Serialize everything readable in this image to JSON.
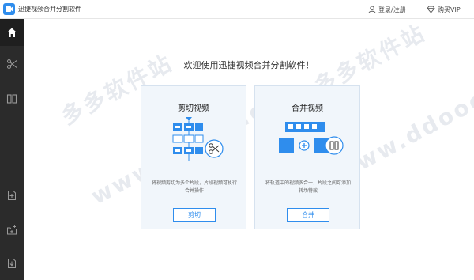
{
  "titlebar": {
    "title": "迅捷视频合并分割软件",
    "login_label": "登录/注册",
    "vip_label": "购买VIP"
  },
  "sidebar": {
    "items": [
      {
        "icon": "home-icon",
        "active": true
      },
      {
        "icon": "scissors-icon",
        "active": false
      },
      {
        "icon": "merge-icon",
        "active": false
      },
      {
        "icon": "add-file-icon",
        "active": false
      },
      {
        "icon": "add-folder-icon",
        "active": false
      },
      {
        "icon": "export-icon",
        "active": false
      }
    ]
  },
  "main": {
    "welcome": "欢迎使用迅捷视频合并分割软件！",
    "watermarks": [
      "多多软件站",
      "www.ddooo.com",
      "多多软件站",
      "www.ddooo.com"
    ],
    "cards": [
      {
        "title": "剪切视频",
        "desc": "将视频剪切为多个片段，片段视频可执行合并操作",
        "button": "剪切"
      },
      {
        "title": "合并视频",
        "desc": "将轨道中的视频多合一，片段之间可添加转场特效",
        "button": "合并"
      }
    ]
  },
  "colors": {
    "accent": "#2f8ded",
    "sidebar_bg": "#2b2b2b",
    "card_bg": "#f1f6fb"
  }
}
